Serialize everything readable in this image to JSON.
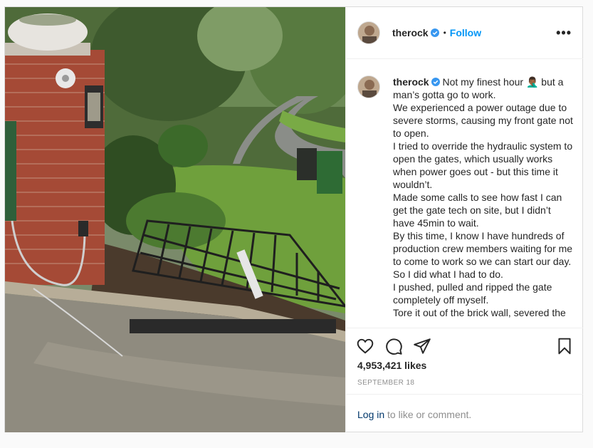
{
  "post": {
    "author": "therock",
    "follow_label": "Follow",
    "separator": "•",
    "more_label": "•••",
    "verified_color": "#3897f0",
    "photo_description_icon": "photo",
    "caption_lines": [
      "Not my finest hour 🤦🏾‍♂️ but a man’s gotta go to work.",
      "We experienced a power outage due to severe storms, causing my front gate not to open.",
      "I tried to override the hydraulic system to open the gates, which usually works when power goes out - but this time it wouldn’t.",
      "Made some calls to see how fast I can get the gate tech on site, but I didn’t have 45min to wait.",
      "By this time, I know I have hundreds of production crew members waiting for me to come to work so we can start our day.",
      "So I did what I had to do.",
      "I pushed, pulled and ripped the gate completely off myself.",
      "Tore it out of the brick wall, severed the"
    ],
    "likes": "4,953,421 likes",
    "date": "SEPTEMBER 18",
    "login_label": "Log in",
    "comment_prompt": " to like or comment."
  },
  "icons": {
    "like": "heart-icon",
    "comment": "comment-icon",
    "share": "share-icon",
    "save": "bookmark-icon"
  }
}
